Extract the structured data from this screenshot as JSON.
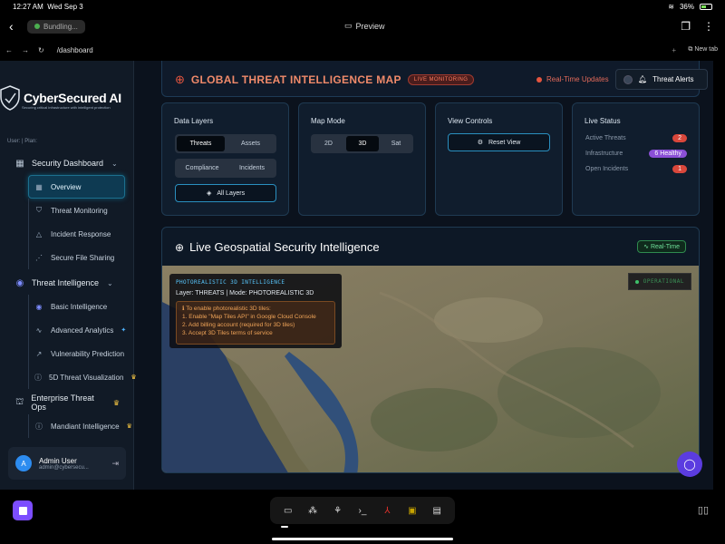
{
  "status": {
    "time": "12:27 AM",
    "date": "Wed Sep 3",
    "battery": "36%"
  },
  "browser": {
    "bundling": "Bundling...",
    "title": "Preview",
    "url": "/dashboard",
    "new_tab": "New tab"
  },
  "brand": {
    "name": "CyberSecured AI",
    "tagline": "Securing critical infrastructure with intelligent protection"
  },
  "sidebar": {
    "user_plan": "User: | Plan:",
    "sections": [
      {
        "label": "Security Dashboard"
      },
      {
        "label": "Threat Intelligence"
      },
      {
        "label": "Enterprise Threat Ops"
      }
    ],
    "items": [
      {
        "label": "Overview"
      },
      {
        "label": "Threat Monitoring"
      },
      {
        "label": "Incident Response"
      },
      {
        "label": "Secure File Sharing"
      },
      {
        "label": "Basic Intelligence"
      },
      {
        "label": "Advanced Analytics"
      },
      {
        "label": "Vulnerability Prediction"
      },
      {
        "label": "5D Threat Visualization"
      },
      {
        "label": "Mandiant Intelligence"
      }
    ],
    "user": {
      "name": "Admin User",
      "email": "admin@cybersecu...",
      "initial": "A"
    }
  },
  "header": {
    "title": "GLOBAL THREAT INTELLIGENCE MAP",
    "badge": "LIVE MONITORING",
    "realtime": "Real-Time Updates",
    "alerts": "Threat Alerts"
  },
  "data_layers": {
    "title": "Data Layers",
    "options": [
      "Threats",
      "Assets",
      "Compliance",
      "Incidents"
    ],
    "selected": "Threats",
    "all": "All Layers"
  },
  "map_mode": {
    "title": "Map Mode",
    "options": [
      "2D",
      "3D",
      "Sat"
    ],
    "selected": "3D"
  },
  "view_controls": {
    "title": "View Controls",
    "reset": "Reset View"
  },
  "live_status": {
    "title": "Live Status",
    "rows": [
      {
        "label": "Active Threats",
        "value": "2",
        "color": "#d9473b"
      },
      {
        "label": "Infrastructure",
        "value": "6 Healthy",
        "color": "#8b4fd6"
      },
      {
        "label": "Open Incidents",
        "value": "1",
        "color": "#d9473b"
      }
    ]
  },
  "geo": {
    "title": "Live Geospatial Security Intelligence",
    "badge": "Real-Time",
    "overlay": {
      "mode": "PHOTOREALISTIC 3D INTELLIGENCE",
      "layer": "Layer: THREATS | Mode: PHOTOREALISTIC 3D",
      "lines": [
        "To enable photorealistic 3D tiles:",
        "1. Enable \"Map Tiles API\" in Google Cloud Console",
        "2. Add billing account (required for 3D tiles)",
        "3. Accept 3D Tiles terms of service"
      ]
    },
    "operational": "OPERATIONAL"
  },
  "icons": {
    "logo": "shield-icon",
    "globe": "globe-icon",
    "bell": "bell-icon",
    "chat": "chat-icon",
    "settings": "gear-icon",
    "layers": "layers-icon"
  },
  "colors": {
    "accent": "#2a8fbf",
    "danger": "#e5553f",
    "success": "#3ec16a",
    "purple": "#8b4fd6"
  }
}
